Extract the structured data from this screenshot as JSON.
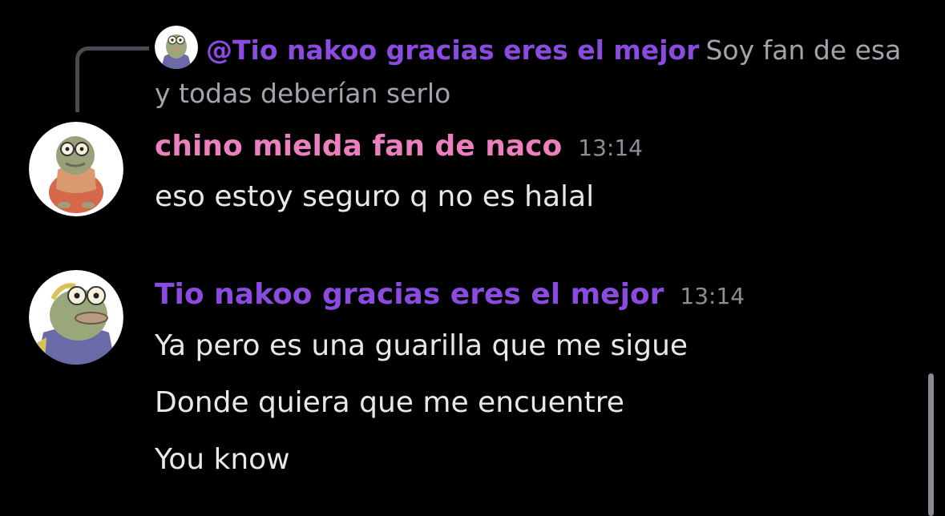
{
  "reply": {
    "author": "@Tio nakoo gracias eres el mejor",
    "text": "Soy fan de esa y todas deberían serlo",
    "avatar_icon": "fish-character-avatar-icon"
  },
  "messages": [
    {
      "author": "chino mielda fan de naco",
      "timestamp": "13:14",
      "color": "#ec7fbd",
      "avatar_icon": "fish-with-glasses-avatar-icon",
      "lines": [
        "eso estoy seguro q no es halal"
      ]
    },
    {
      "author": "Tio nakoo gracias eres el mejor",
      "timestamp": "13:14",
      "color": "#8b4ae0",
      "avatar_icon": "fish-character-avatar-icon",
      "lines": [
        "Ya pero es una guarilla que me sigue",
        "Donde quiera que me encuentre",
        "You know"
      ]
    }
  ]
}
